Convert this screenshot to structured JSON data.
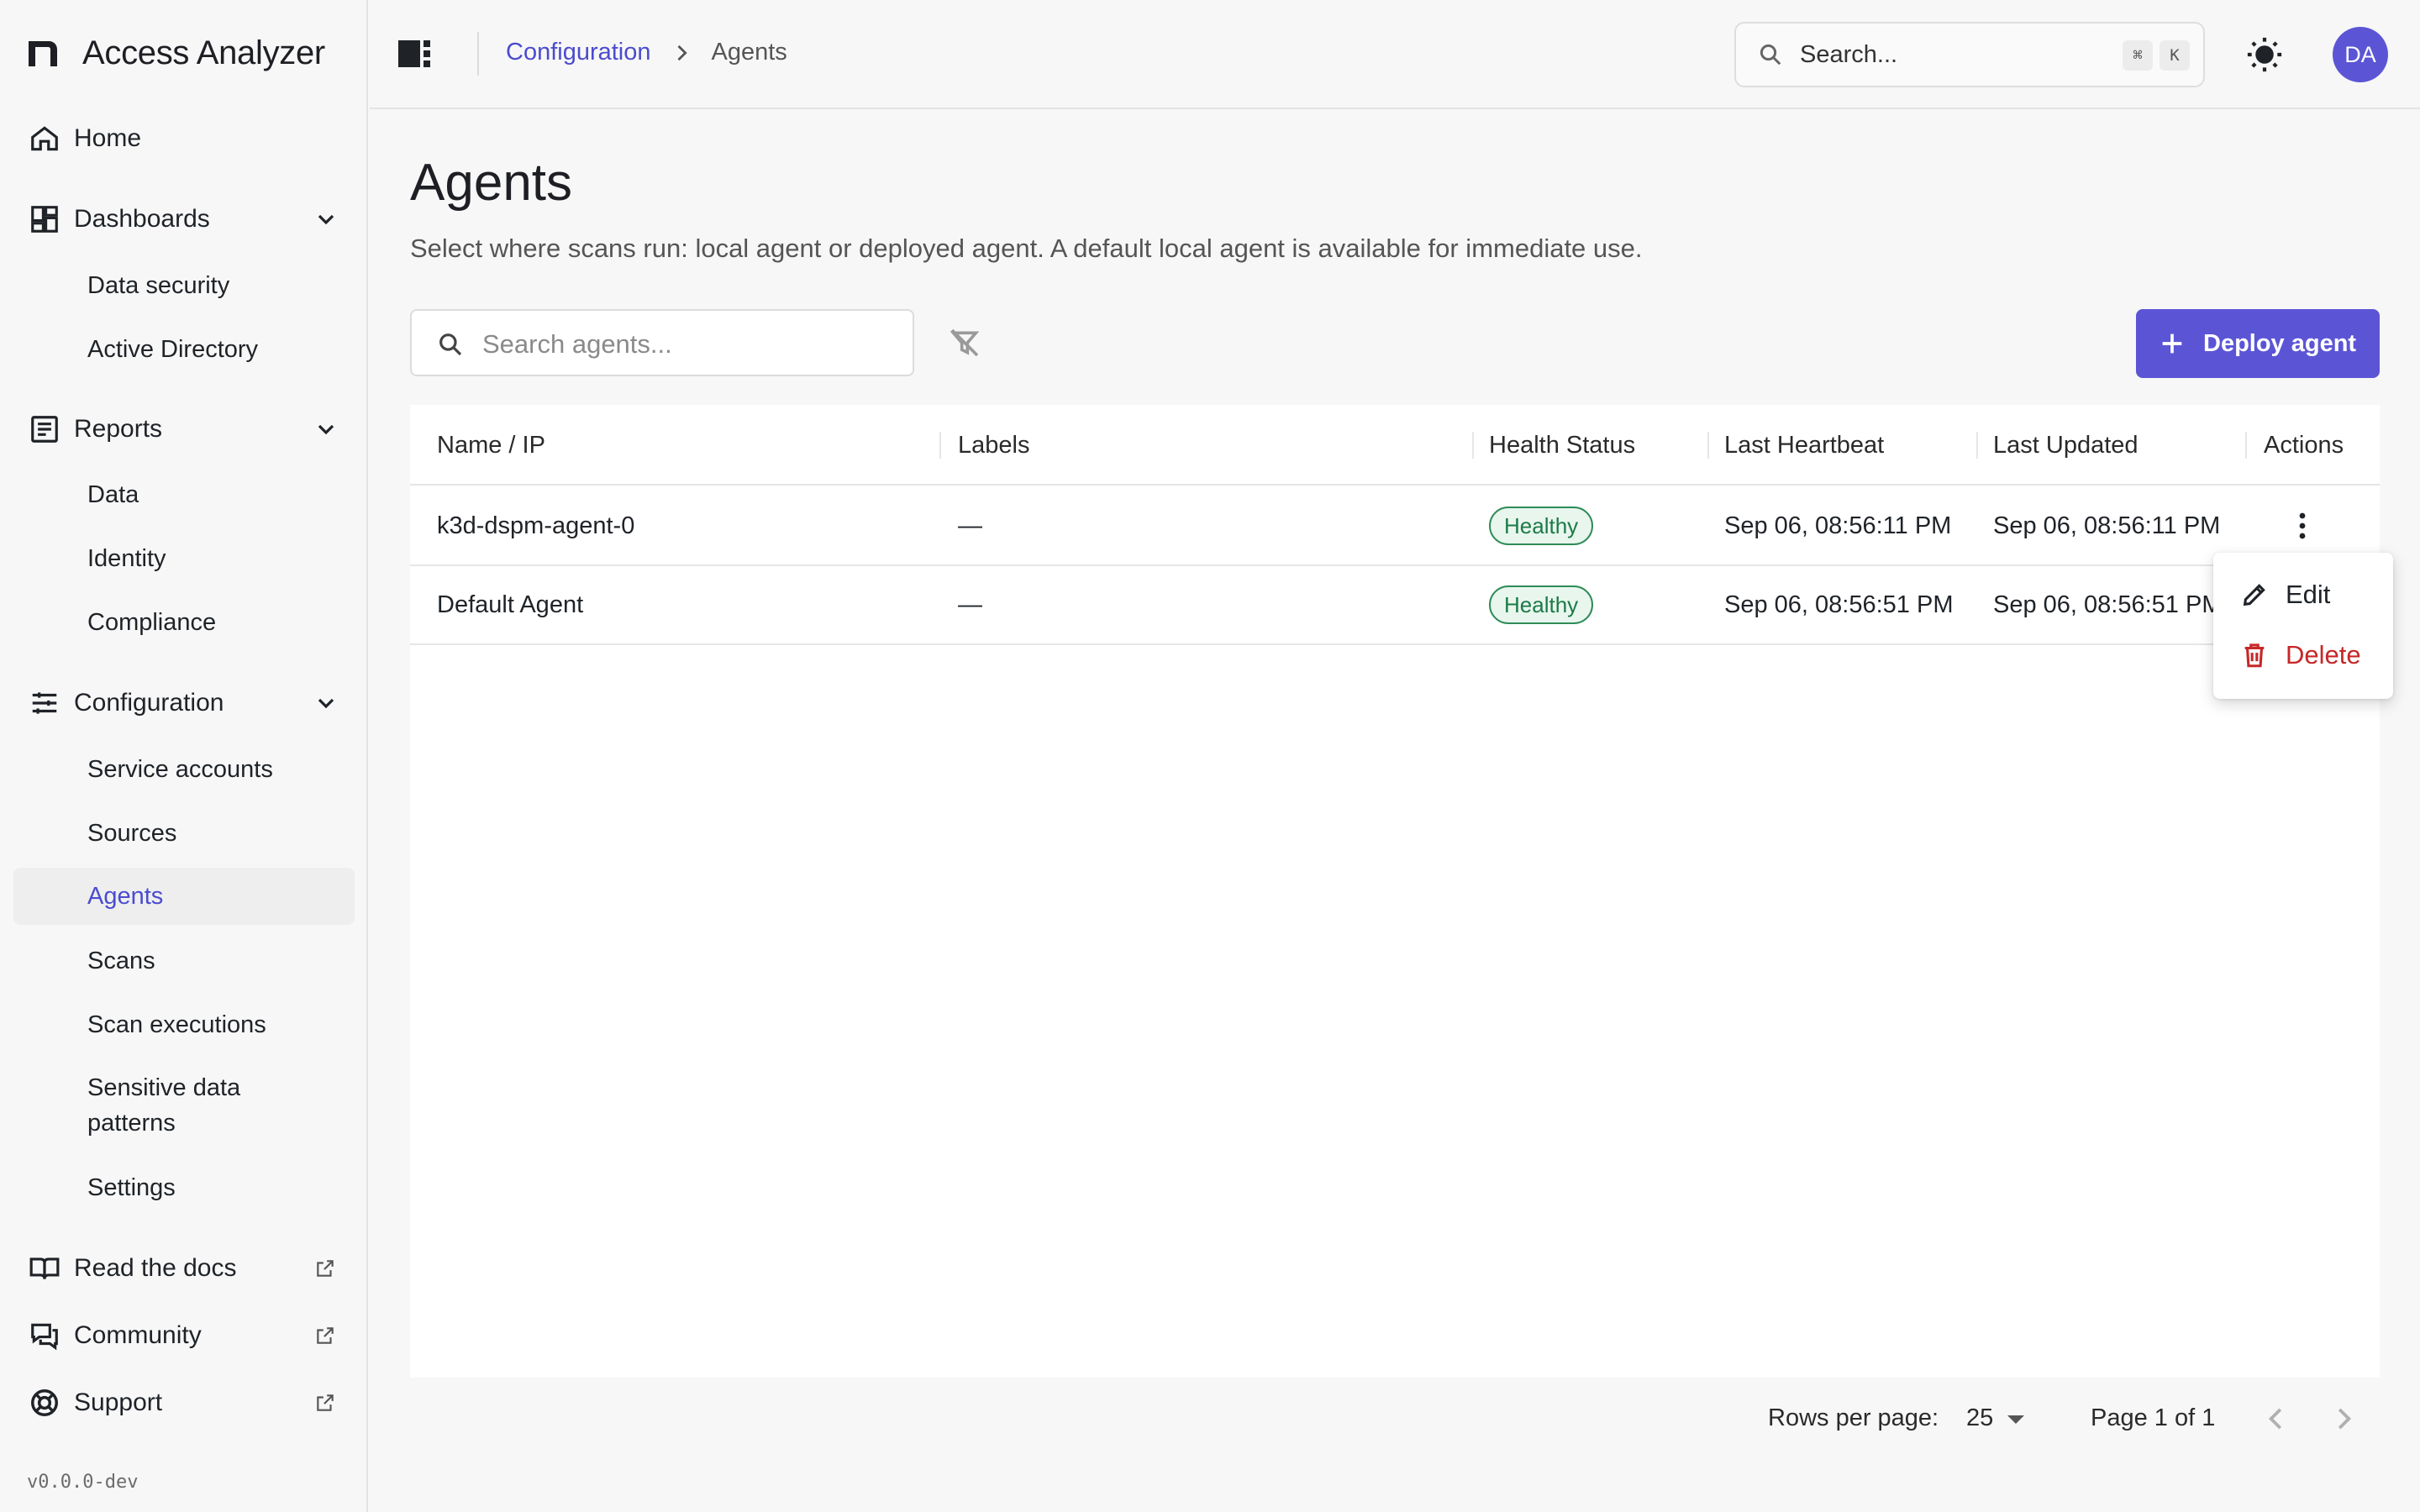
{
  "app": {
    "name": "Access Analyzer",
    "version": "v0.0.0-dev"
  },
  "sidebar": {
    "home": "Home",
    "dashboards": {
      "label": "Dashboards",
      "items": [
        "Data security",
        "Active Directory"
      ]
    },
    "reports": {
      "label": "Reports",
      "items": [
        "Data",
        "Identity",
        "Compliance"
      ]
    },
    "configuration": {
      "label": "Configuration",
      "items": [
        "Service accounts",
        "Sources",
        "Agents",
        "Scans",
        "Scan executions",
        "Sensitive data patterns",
        "Settings"
      ],
      "active": "Agents"
    },
    "external": [
      "Read the docs",
      "Community",
      "Support"
    ]
  },
  "topbar": {
    "breadcrumb": [
      "Configuration",
      "Agents"
    ],
    "search_placeholder": "Search...",
    "shortcut_keys": [
      "⌘",
      "K"
    ],
    "avatar_initials": "DA"
  },
  "page": {
    "title": "Agents",
    "description": "Select where scans run: local agent or deployed agent. A default local agent is available for immediate use.",
    "search_placeholder": "Search agents...",
    "deploy_button": "Deploy agent"
  },
  "table": {
    "columns": [
      "Name / IP",
      "Labels",
      "Health Status",
      "Last Heartbeat",
      "Last Updated",
      "Actions"
    ],
    "rows": [
      {
        "name": "k3d-dspm-agent-0",
        "labels": "—",
        "health": "Healthy",
        "last_heartbeat": "Sep 06, 08:56:11 PM",
        "last_updated": "Sep 06, 08:56:11 PM"
      },
      {
        "name": "Default Agent",
        "labels": "—",
        "health": "Healthy",
        "last_heartbeat": "Sep 06, 08:56:51 PM",
        "last_updated": "Sep 06, 08:56:51 PM"
      }
    ]
  },
  "row_menu": {
    "edit": "Edit",
    "delete": "Delete"
  },
  "pagination": {
    "rows_per_page_label": "Rows per page:",
    "rows_per_page": "25",
    "page_info": "Page 1 of 1"
  },
  "colors": {
    "accent": "#5b55d6",
    "link": "#4b4bd0",
    "success": "#1d7a46",
    "danger": "#c62828"
  }
}
